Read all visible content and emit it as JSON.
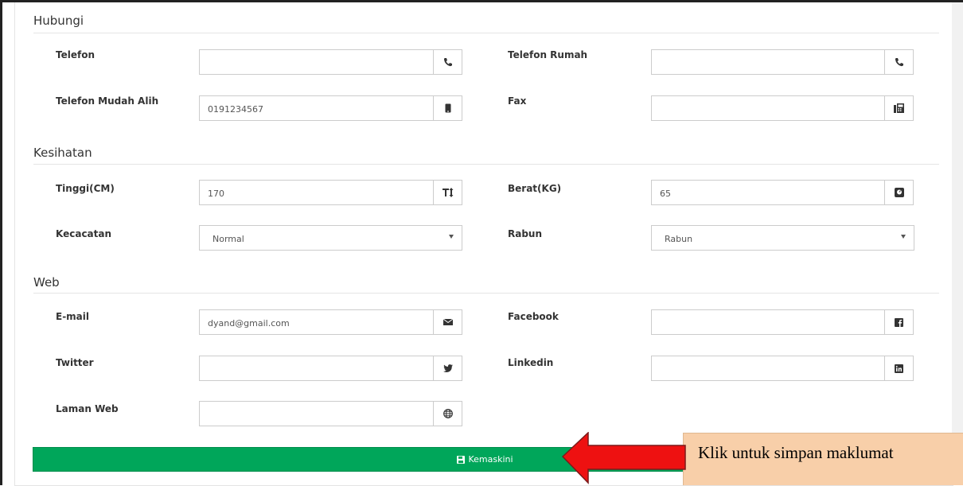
{
  "sections": {
    "hubungi": "Hubungi",
    "kesihatan": "Kesihatan",
    "web": "Web"
  },
  "fields": {
    "telefon": {
      "label": "Telefon",
      "value": "",
      "icon": "phone-icon"
    },
    "telefon_rumah": {
      "label": "Telefon Rumah",
      "value": "",
      "icon": "phone-icon"
    },
    "telefon_mudah_alih": {
      "label": "Telefon Mudah Alih",
      "value": "0191234567",
      "icon": "mobile-icon"
    },
    "fax": {
      "label": "Fax",
      "value": "",
      "icon": "fax-icon"
    },
    "tinggi": {
      "label": "Tinggi(CM)",
      "value": "170",
      "icon": "text-height-icon"
    },
    "berat": {
      "label": "Berat(KG)",
      "value": "65",
      "icon": "scale-icon"
    },
    "kecacatan": {
      "label": "Kecacatan",
      "value": "Normal"
    },
    "rabun": {
      "label": "Rabun",
      "value": "Rabun"
    },
    "email": {
      "label": "E-mail",
      "value": "dyand@gmail.com",
      "icon": "envelope-icon"
    },
    "facebook": {
      "label": "Facebook",
      "value": "",
      "icon": "facebook-icon"
    },
    "twitter": {
      "label": "Twitter",
      "value": "",
      "icon": "twitter-icon"
    },
    "linkedin": {
      "label": "Linkedin",
      "value": "",
      "icon": "linkedin-icon"
    },
    "laman_web": {
      "label": "Laman Web",
      "value": "",
      "icon": "globe-icon"
    }
  },
  "save_button": {
    "label": "Kemaskini",
    "color": "#00a65a"
  },
  "callout": {
    "text": "Klik untuk simpan maklumat",
    "background": "#f8cfa9",
    "arrow_color": "#ee1111"
  }
}
